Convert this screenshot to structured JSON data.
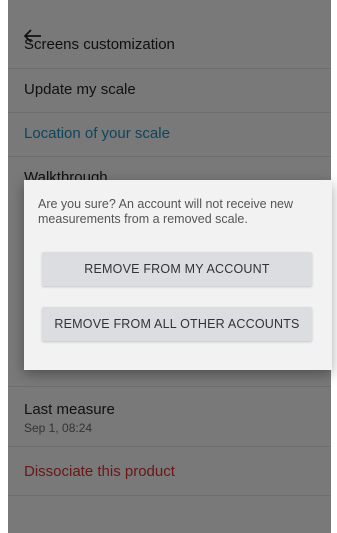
{
  "header": {
    "title": "Screens customization"
  },
  "menu": {
    "update_scale": "Update my scale",
    "location_scale": "Location of your scale",
    "walkthrough": "Walkthrough",
    "last_measure_label": "Last measure",
    "last_measure_value": "Sep 1, 08:24",
    "dissociate": "Dissociate this product"
  },
  "dialog": {
    "message": "Are you sure? An account will not receive new measurements from a removed scale.",
    "remove_my_account": "REMOVE FROM MY ACCOUNT",
    "remove_all_other": "REMOVE FROM ALL OTHER ACCOUNTS"
  },
  "colors": {
    "link_blue": "#1f8ab8",
    "danger_red": "#d32f2f",
    "scrim": "rgba(0,0,0,0.5)"
  }
}
